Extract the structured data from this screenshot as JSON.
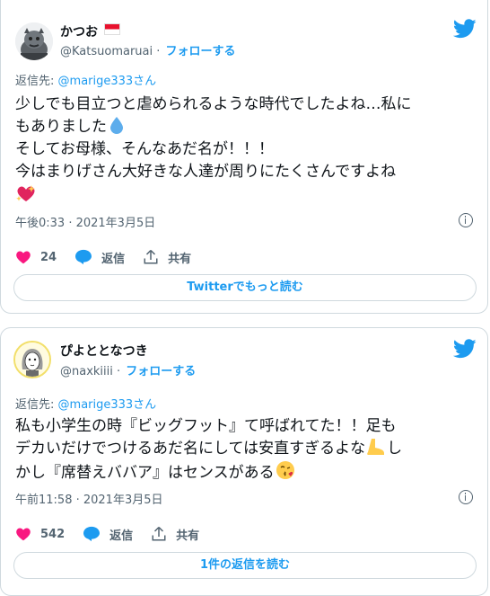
{
  "tweets": [
    {
      "display_name": "かつお",
      "handle": "@Katsuomaruai",
      "separator": "·",
      "follow_label": "フォローする",
      "reply_prefix": "返信先:",
      "reply_to": "@marige333さん",
      "lines": [
        "少しでも目立つと虐められるような時代でしたよね…私に",
        "もありました",
        "そしてお母様、そんなあだ名が！！！",
        "今はまりげさん大好きな人達が周りにたくさんですよね"
      ],
      "timestamp": "午後0:33 · 2021年3月5日",
      "likes": "24",
      "reply_label": "返信",
      "share_label": "共有",
      "more_button": "Twitterでもっと読む"
    },
    {
      "display_name": "ぴよととなつき",
      "handle": "@naxkiiii",
      "separator": "·",
      "follow_label": "フォローする",
      "reply_prefix": "返信先:",
      "reply_to": "@marige333さん",
      "lines": [
        "私も小学生の時『ビッグフット』て呼ばれてた！！足も",
        "デカいだけでつけるあだ名にしては安直すぎるよな",
        "かし『席替えババア』はセンスがある"
      ],
      "line2_tail": "し",
      "timestamp": "午前11:58 · 2021年3月5日",
      "likes": "542",
      "reply_label": "返信",
      "share_label": "共有",
      "more_button": "1件の返信を読む"
    }
  ],
  "colors": {
    "accent": "#1d9bf0",
    "like": "#f91880",
    "muted": "#536471",
    "border": "#cfd9de"
  },
  "icons": [
    "twitter-bird-icon",
    "heart-icon",
    "reply-bubble-icon",
    "share-icon",
    "info-icon",
    "droplet-emoji-icon",
    "sparkling-heart-emoji-icon",
    "foot-emoji-icon",
    "kiss-face-emoji-icon",
    "flag-icon"
  ]
}
